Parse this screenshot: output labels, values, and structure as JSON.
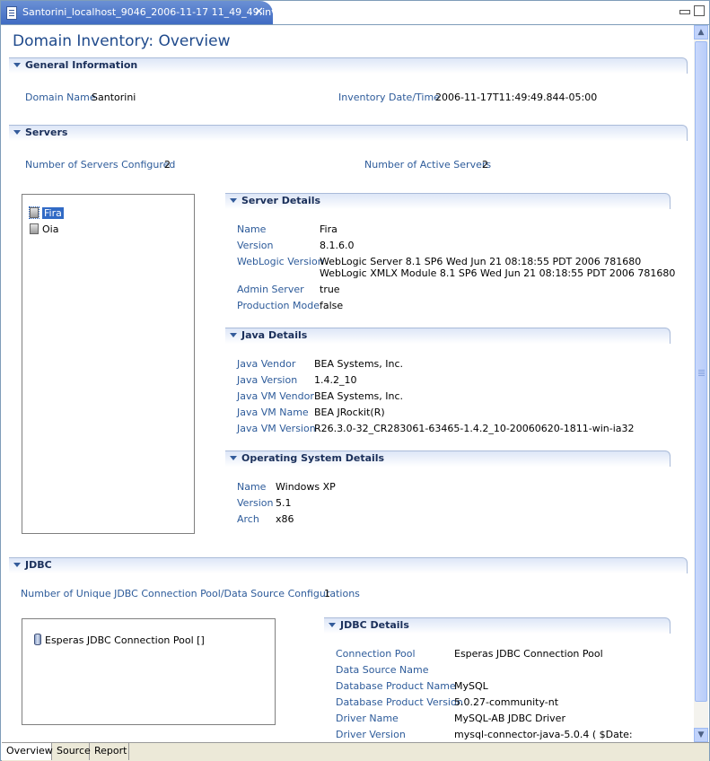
{
  "tab": {
    "title": "Santorini_localhost_9046_2006-11-17 11_49_49.inv",
    "close": "✕"
  },
  "page_title": "Domain Inventory: Overview",
  "general": {
    "title": "General Information",
    "domain_name_label": "Domain Name",
    "domain_name": "Santorini",
    "inventory_date_label": "Inventory Date/Time",
    "inventory_date": "2006-11-17T11:49:49.844-05:00"
  },
  "servers": {
    "title": "Servers",
    "configured_label": "Number of Servers Configured",
    "configured": "2",
    "active_label": "Number of Active Servers",
    "active": "2",
    "list": [
      "Fira",
      "Oia"
    ]
  },
  "server_details": {
    "title": "Server Details",
    "name_label": "Name",
    "name": "Fira",
    "version_label": "Version",
    "version": "8.1.6.0",
    "weblogic_label": "WebLogic Version",
    "weblogic_1": "WebLogic Server 8.1 SP6  Wed Jun 21 08:18:55 PDT 2006 781680",
    "weblogic_2": "WebLogic XMLX Module 8.1 SP6  Wed Jun 21 08:18:55 PDT 2006 781680",
    "admin_label": "Admin Server",
    "admin": "true",
    "prod_label": "Production Mode",
    "prod": "false"
  },
  "java_details": {
    "title": "Java Details",
    "vendor_label": "Java Vendor",
    "vendor": "BEA Systems, Inc.",
    "version_label": "Java Version",
    "version": "1.4.2_10",
    "vm_vendor_label": "Java VM Vendor",
    "vm_vendor": "BEA Systems, Inc.",
    "vm_name_label": "Java VM Name",
    "vm_name": "BEA JRockit(R)",
    "vm_version_label": "Java VM Version",
    "vm_version": "R26.3.0-32_CR283061-63465-1.4.2_10-20060620-1811-win-ia32"
  },
  "os_details": {
    "title": "Operating System Details",
    "name_label": "Name",
    "name": "Windows XP",
    "version_label": "Version",
    "version": "5.1",
    "arch_label": "Arch",
    "arch": "x86"
  },
  "jdbc": {
    "title": "JDBC",
    "unique_label": "Number of Unique JDBC Connection Pool/Data Source Configurations",
    "unique": "1",
    "pool_item": "Esperas JDBC Connection Pool []"
  },
  "jdbc_details": {
    "title": "JDBC Details",
    "pool_label": "Connection Pool",
    "pool": "Esperas JDBC Connection Pool",
    "ds_label": "Data Source Name",
    "ds": "",
    "product_label": "Database Product Name",
    "product": "MySQL",
    "product_version_label": "Database Product Version",
    "product_version": "5.0.27-community-nt",
    "driver_label": "Driver Name",
    "driver": "MySQL-AB JDBC Driver",
    "driver_version_label": "Driver Version",
    "driver_version": "mysql-connector-java-5.0.4 ( $Date:"
  },
  "bottom_tabs": [
    "Overview",
    "Source",
    "Report"
  ]
}
